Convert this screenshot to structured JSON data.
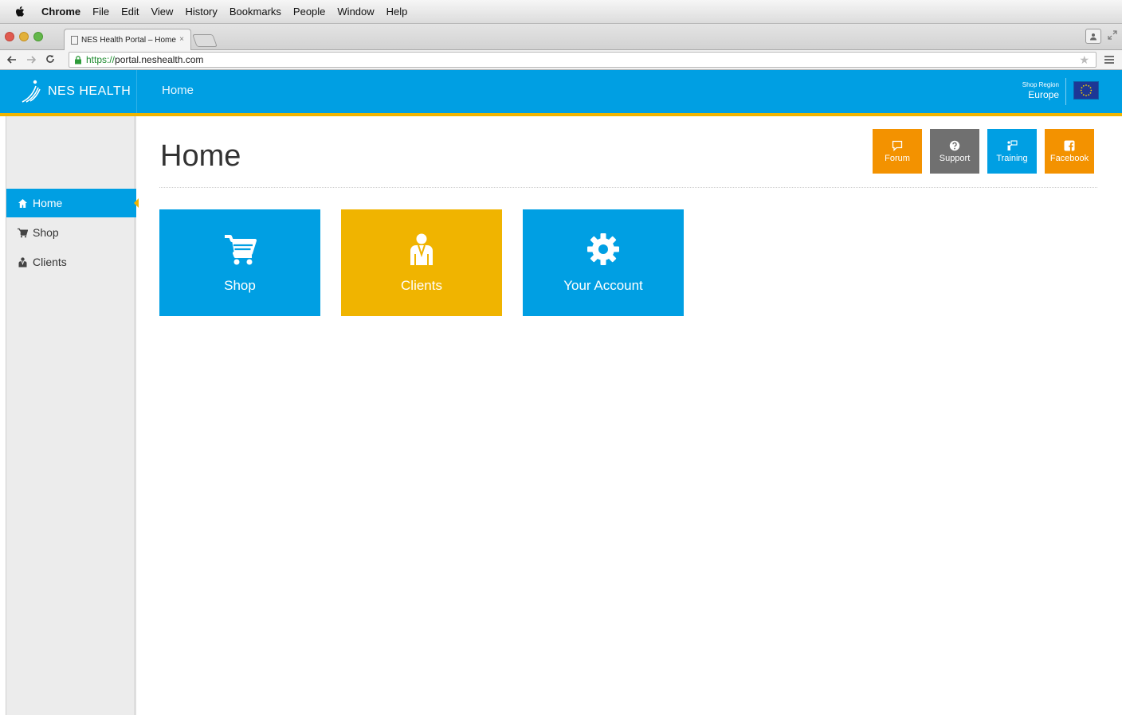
{
  "menubar": {
    "items": [
      "Chrome",
      "File",
      "Edit",
      "View",
      "History",
      "Bookmarks",
      "People",
      "Window",
      "Help"
    ]
  },
  "browser": {
    "tab_title": "NES Health Portal – Home",
    "tab_close": "×",
    "url_scheme": "https://",
    "url_host": "portal.neshealth.com"
  },
  "header": {
    "brand": "NES HEALTH",
    "title": "Home",
    "region_label": "Shop Region",
    "region_value": "Europe"
  },
  "sidebar": {
    "items": [
      {
        "label": "Home",
        "icon": "home-icon",
        "active": true
      },
      {
        "label": "Shop",
        "icon": "cart-icon",
        "active": false
      },
      {
        "label": "Clients",
        "icon": "person-icon",
        "active": false
      }
    ]
  },
  "main": {
    "title": "Home",
    "quick_links": [
      {
        "label": "Forum",
        "icon": "comment-icon",
        "color": "#f39200"
      },
      {
        "label": "Support",
        "icon": "question-icon",
        "color": "#707070"
      },
      {
        "label": "Training",
        "icon": "presenter-icon",
        "color": "#009fe3"
      },
      {
        "label": "Facebook",
        "icon": "facebook-icon",
        "color": "#f39200"
      }
    ],
    "tiles": [
      {
        "label": "Shop",
        "icon": "cart-icon",
        "color": "#009fe3"
      },
      {
        "label": "Clients",
        "icon": "person-icon",
        "color": "#f0b400"
      },
      {
        "label": "Your Account",
        "icon": "gear-icon",
        "color": "#009fe3"
      }
    ]
  },
  "colors": {
    "brand_blue": "#009fe3",
    "accent_yellow": "#f0b400",
    "accent_orange": "#f39200"
  }
}
